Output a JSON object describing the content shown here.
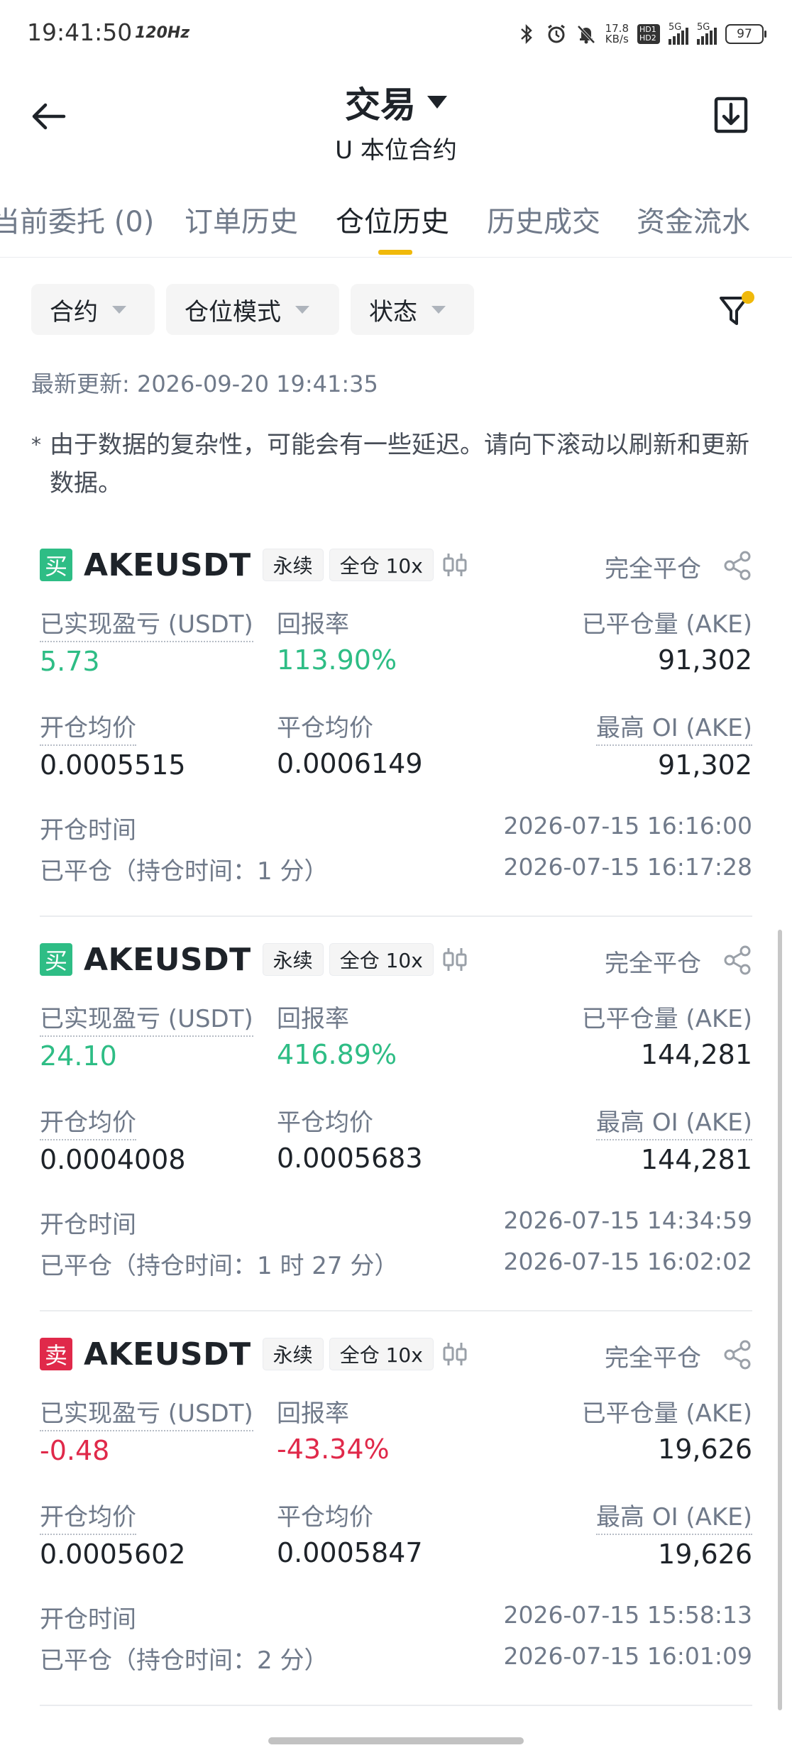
{
  "status_bar": {
    "time": "19:41:50",
    "refresh_rate": "120Hz",
    "net_speed_value": "17.8",
    "net_speed_unit": "KB/s",
    "hd_badge": "HD1 HD2",
    "sim1_label": "5G",
    "sim2_label": "5G",
    "battery": "97"
  },
  "header": {
    "title": "交易",
    "subtitle": "U 本位合约"
  },
  "tabs": [
    {
      "label": "当前委托 (0)",
      "active": false
    },
    {
      "label": "订单历史",
      "active": false
    },
    {
      "label": "仓位历史",
      "active": true
    },
    {
      "label": "历史成交",
      "active": false
    },
    {
      "label": "资金流水",
      "active": false
    }
  ],
  "filters": {
    "contract": "合约",
    "position_mode": "仓位模式",
    "status": "状态"
  },
  "last_updated": "最新更新: 2026-09-20 19:41:35",
  "notice": {
    "star": "*",
    "text": "由于数据的复杂性，可能会有一些延迟。请向下滚动以刷新和更新数据。"
  },
  "labels": {
    "realized_pnl": "已实现盈亏 (USDT)",
    "roi": "回报率",
    "closed_qty": "已平仓量 (AKE)",
    "entry_price": "开仓均价",
    "close_price": "平仓均价",
    "max_oi": "最高 OI (AKE)",
    "open_time": "开仓时间"
  },
  "positions": [
    {
      "side": "买",
      "side_color": "#2ebd85",
      "symbol": "AKEUSDT",
      "type_tag": "永续",
      "margin_tag": "全仓 10x",
      "status": "完全平仓",
      "realized_pnl": "5.73",
      "roi": "113.90%",
      "pnl_sign": "pos",
      "closed_qty": "91,302",
      "entry_price": "0.0005515",
      "close_price": "0.0006149",
      "max_oi": "91,302",
      "open_time": "2026-07-15 16:16:00",
      "closed_text": "已平仓（持仓时间：1 分）",
      "close_time": "2026-07-15 16:17:28"
    },
    {
      "side": "买",
      "side_color": "#2ebd85",
      "symbol": "AKEUSDT",
      "type_tag": "永续",
      "margin_tag": "全仓 10x",
      "status": "完全平仓",
      "realized_pnl": "24.10",
      "roi": "416.89%",
      "pnl_sign": "pos",
      "closed_qty": "144,281",
      "entry_price": "0.0004008",
      "close_price": "0.0005683",
      "max_oi": "144,281",
      "open_time": "2026-07-15 14:34:59",
      "closed_text": "已平仓（持仓时间：1 时 27 分）",
      "close_time": "2026-07-15 16:02:02"
    },
    {
      "side": "卖",
      "side_color": "#e0294a",
      "symbol": "AKEUSDT",
      "type_tag": "永续",
      "margin_tag": "全仓 10x",
      "status": "完全平仓",
      "realized_pnl": "-0.48",
      "roi": "-43.34%",
      "pnl_sign": "neg",
      "closed_qty": "19,626",
      "entry_price": "0.0005602",
      "close_price": "0.0005847",
      "max_oi": "19,626",
      "open_time": "2026-07-15 15:58:13",
      "closed_text": "已平仓（持仓时间：2 分）",
      "close_time": "2026-07-15 16:01:09"
    }
  ],
  "colors": {
    "accent": "#f0b90b",
    "positive": "#2ebd85",
    "negative": "#e0294a",
    "muted_text": "#707a8a"
  }
}
